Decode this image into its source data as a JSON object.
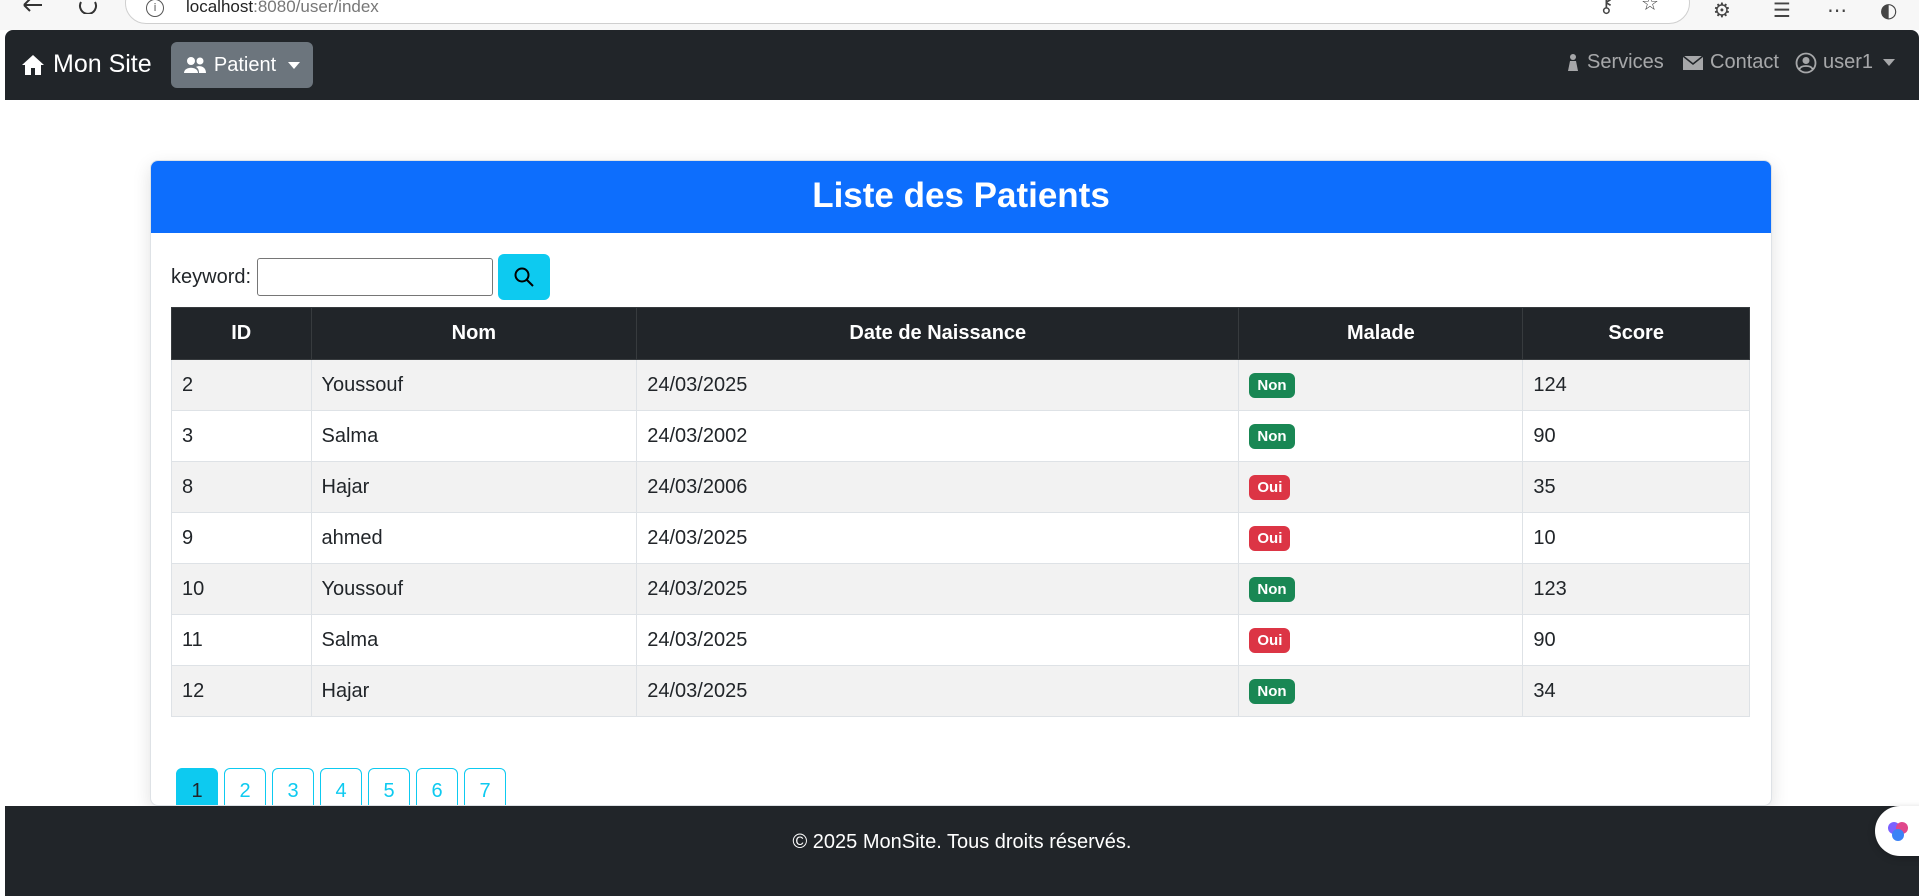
{
  "browser": {
    "url_host": "localhost",
    "url_path": ":8080/user/index"
  },
  "navbar": {
    "brand": "Mon Site",
    "patient_menu": "Patient",
    "services": "Services",
    "contact": "Contact",
    "user": "user1"
  },
  "card": {
    "title": "Liste des Patients",
    "search_label": "keyword:",
    "search_value": ""
  },
  "table": {
    "headers": [
      "ID",
      "Nom",
      "Date de Naissance",
      "Malade",
      "Score"
    ],
    "rows": [
      {
        "id": "2",
        "nom": "Youssouf",
        "date": "24/03/2025",
        "malade": "Non",
        "score": "124"
      },
      {
        "id": "3",
        "nom": "Salma",
        "date": "24/03/2002",
        "malade": "Non",
        "score": "90"
      },
      {
        "id": "8",
        "nom": "Hajar",
        "date": "24/03/2006",
        "malade": "Oui",
        "score": "35"
      },
      {
        "id": "9",
        "nom": "ahmed",
        "date": "24/03/2025",
        "malade": "Oui",
        "score": "10"
      },
      {
        "id": "10",
        "nom": "Youssouf",
        "date": "24/03/2025",
        "malade": "Non",
        "score": "123"
      },
      {
        "id": "11",
        "nom": "Salma",
        "date": "24/03/2025",
        "malade": "Oui",
        "score": "90"
      },
      {
        "id": "12",
        "nom": "Hajar",
        "date": "24/03/2025",
        "malade": "Non",
        "score": "34"
      }
    ]
  },
  "pagination": {
    "pages": [
      "1",
      "2",
      "3",
      "4",
      "5",
      "6",
      "7"
    ],
    "active": "1"
  },
  "footer": {
    "text": "© 2025 MonSite. Tous droits réservés."
  },
  "colors": {
    "navbar": "#212529",
    "header": "#0d6efd",
    "info": "#0dcaf0",
    "success": "#198754",
    "danger": "#dc3545"
  }
}
